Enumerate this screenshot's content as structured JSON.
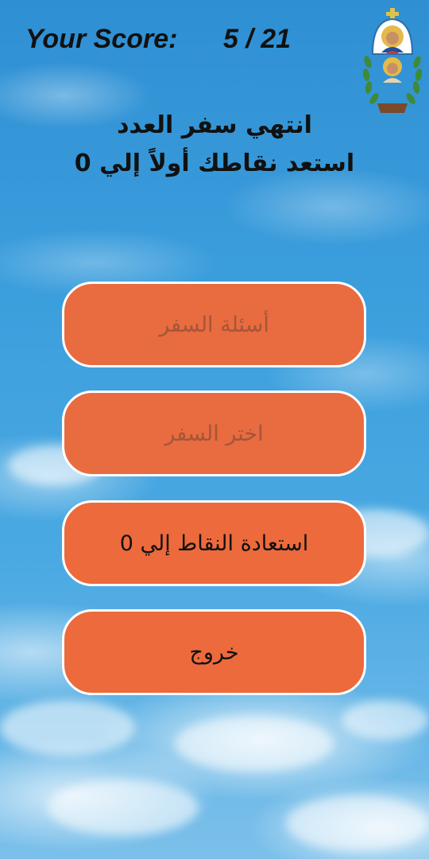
{
  "header": {
    "score_label": "Your Score:",
    "score_value": "5 / 21"
  },
  "logo": {
    "icon": "church-saints-logo-icon"
  },
  "message": {
    "line1": "انتهي سفر العدد",
    "line2": "استعد نقاطك أولاً إلي 0"
  },
  "menu": {
    "items": [
      {
        "label": "أسئلة السفر",
        "enabled": false
      },
      {
        "label": "اختر السفر",
        "enabled": false
      },
      {
        "label": "استعادة النقاط إلي 0",
        "enabled": true
      },
      {
        "label": "خروج",
        "enabled": true
      }
    ]
  },
  "colors": {
    "sky": "#3a9bd8",
    "button_fill": "#ec6a3c",
    "button_border": "#ffffff",
    "text": "#111111",
    "disabled_text": "#a45638"
  }
}
